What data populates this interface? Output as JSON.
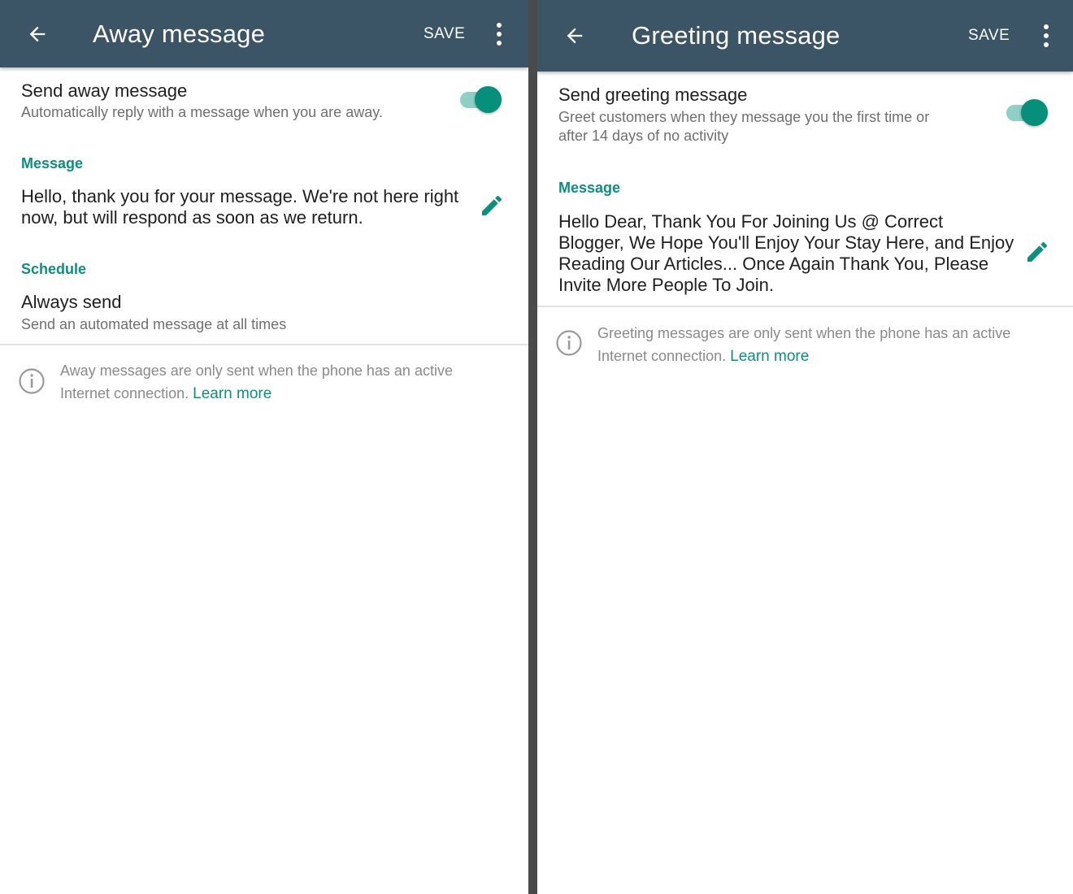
{
  "colors": {
    "appbar": "#3b5466",
    "accent": "#0d8f7f",
    "toggle_thumb": "#068f7b",
    "toggle_track": "#8fd0c6"
  },
  "left": {
    "title": "Away message",
    "save_label": "SAVE",
    "toggle": {
      "title": "Send away message",
      "subtitle": "Automatically reply with a message when you are away.",
      "enabled": true
    },
    "message_header": "Message",
    "message_line1": "Hello, thank you for your message. We're not here right",
    "message_line2": "now, but will respond as soon as we return.",
    "schedule_header": "Schedule",
    "schedule_value": "Always send",
    "schedule_desc": "Send an automated message at all times",
    "info_line1": "Away messages are only sent when the phone has an active",
    "info_line2": "Internet connection.",
    "learn_more": "Learn more"
  },
  "right": {
    "title": "Greeting message",
    "save_label": "SAVE",
    "toggle": {
      "title": "Send greeting message",
      "subtitle_line1": "Greet customers when they message you the first time or",
      "subtitle_line2": "after 14 days of no activity",
      "enabled": true
    },
    "message_header": "Message",
    "message_line1": "Hello Dear, Thank You For Joining Us @ Correct",
    "message_line2": "Blogger, We Hope You'll Enjoy Your Stay Here, and Enjoy",
    "message_line3": "Reading Our Articles... Once Again Thank You, Please",
    "message_line4": "Invite More People To Join.",
    "info_line1": "Greeting messages are only sent when the phone has an active",
    "info_line2": "Internet connection.",
    "learn_more": "Learn more"
  },
  "icons": {
    "back": "arrow-left-icon",
    "menu": "more-vert-icon",
    "edit": "pencil-icon",
    "info": "info-circle-icon"
  }
}
